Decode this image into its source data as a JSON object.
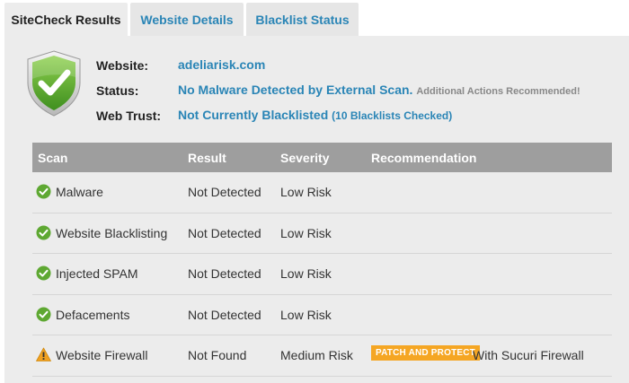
{
  "tabs": [
    {
      "label": "SiteCheck Results",
      "active": true
    },
    {
      "label": "Website Details",
      "active": false
    },
    {
      "label": "Blacklist Status",
      "active": false
    }
  ],
  "summary": {
    "website_label": "Website:",
    "website_value": "adeliarisk.com",
    "status_label": "Status:",
    "status_value": "No Malware Detected by External Scan.",
    "status_note": "Additional Actions Recommended!",
    "trust_label": "Web Trust:",
    "trust_value": "Not Currently Blacklisted",
    "trust_note": "(10 Blacklists Checked)"
  },
  "table": {
    "headers": {
      "scan": "Scan",
      "result": "Result",
      "severity": "Severity",
      "recommendation": "Recommendation"
    },
    "rows": [
      {
        "icon": "check-circle-icon",
        "scan": "Malware",
        "result": "Not Detected",
        "severity": "Low Risk",
        "badge": "",
        "recommendation": ""
      },
      {
        "icon": "check-circle-icon",
        "scan": "Website Blacklisting",
        "result": "Not Detected",
        "severity": "Low Risk",
        "badge": "",
        "recommendation": ""
      },
      {
        "icon": "check-circle-icon",
        "scan": "Injected SPAM",
        "result": "Not Detected",
        "severity": "Low Risk",
        "badge": "",
        "recommendation": ""
      },
      {
        "icon": "check-circle-icon",
        "scan": "Defacements",
        "result": "Not Detected",
        "severity": "Low Risk",
        "badge": "",
        "recommendation": ""
      },
      {
        "icon": "warning-icon",
        "scan": "Website Firewall",
        "result": "Not Found",
        "severity": "Medium Risk",
        "badge": "PATCH AND PROTECT",
        "recommendation": "With Sucuri Firewall"
      }
    ]
  },
  "colors": {
    "link_blue": "#2a85b6",
    "header_gray": "#9e9e9e",
    "badge_orange": "#f5a623",
    "check_green": "#5ea832"
  }
}
